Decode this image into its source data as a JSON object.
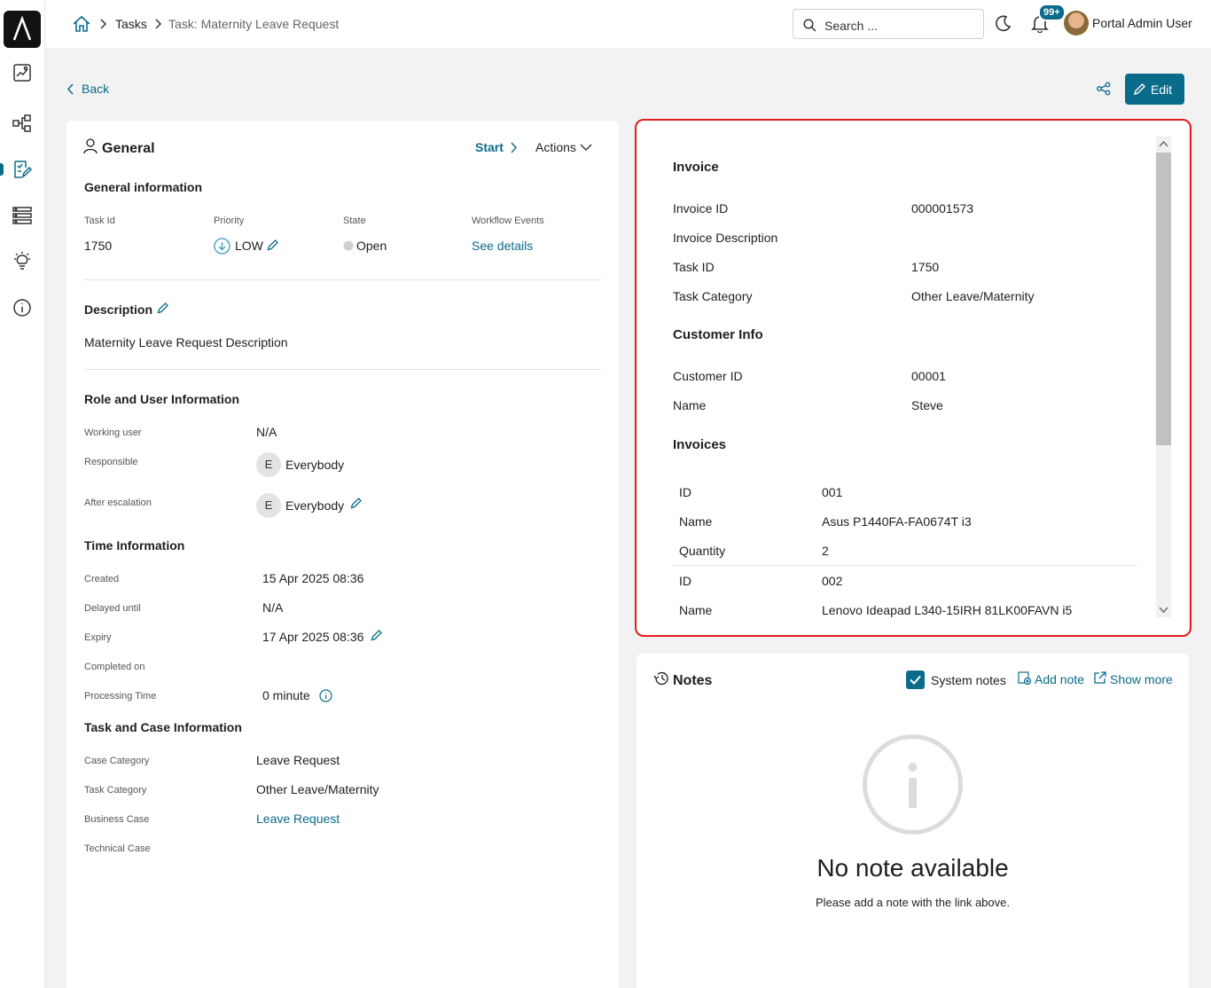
{
  "breadcrumb": {
    "home_icon": "home-icon",
    "tasks": "Tasks",
    "current": "Task: Maternity Leave Request"
  },
  "search": {
    "placeholder": "Search ..."
  },
  "notifications": {
    "badge": "99+"
  },
  "user": {
    "name": "Portal Admin User"
  },
  "toolbar": {
    "back": "Back",
    "edit": "Edit"
  },
  "general": {
    "title": "General",
    "start": "Start",
    "actions": "Actions",
    "info_heading": "General information",
    "task_id_label": "Task Id",
    "task_id": "1750",
    "priority_label": "Priority",
    "priority": "LOW",
    "state_label": "State",
    "state": "Open",
    "workflow_label": "Workflow Events",
    "workflow_link": "See details",
    "description_heading": "Description",
    "description": "Maternity Leave Request Description",
    "role_heading": "Role and User Information",
    "working_user_label": "Working user",
    "working_user": "N/A",
    "responsible_label": "Responsible",
    "responsible_initial": "E",
    "responsible": "Everybody",
    "after_escalation_label": "After escalation",
    "after_escalation_initial": "E",
    "after_escalation": "Everybody",
    "time_heading": "Time Information",
    "created_label": "Created",
    "created": "15 Apr 2025 08:36",
    "delayed_label": "Delayed until",
    "delayed": "N/A",
    "expiry_label": "Expiry",
    "expiry": "17 Apr 2025 08:36",
    "completed_label": "Completed on",
    "processing_label": "Processing Time",
    "processing": "0 minute",
    "case_heading": "Task and Case Information",
    "case_category_label": "Case Category",
    "case_category": "Leave Request",
    "task_category_label": "Task Category",
    "task_category": "Other Leave/Maternity",
    "business_case_label": "Business Case",
    "business_case": "Leave Request",
    "technical_case_label": "Technical Case"
  },
  "invoice_panel": {
    "invoice_heading": "Invoice",
    "invoice_id_label": "Invoice ID",
    "invoice_id": "000001573",
    "invoice_desc_label": "Invoice Description",
    "task_id_label": "Task ID",
    "task_id": "1750",
    "task_category_label": "Task Category",
    "task_category": "Other Leave/Maternity",
    "customer_heading": "Customer Info",
    "customer_id_label": "Customer ID",
    "customer_id": "00001",
    "name_label": "Name",
    "name": "Steve",
    "invoices_heading": "Invoices",
    "items": [
      {
        "id_label": "ID",
        "id": "001",
        "name_label": "Name",
        "name": "Asus P1440FA-FA0674T i3",
        "qty_label": "Quantity",
        "qty": "2"
      },
      {
        "id_label": "ID",
        "id": "002",
        "name_label": "Name",
        "name": "Lenovo Ideapad L340-15IRH 81LK00FAVN i5"
      }
    ]
  },
  "notes": {
    "title": "Notes",
    "system_notes": "System notes",
    "add_note": "Add note",
    "show_more": "Show more",
    "empty_title": "No note available",
    "empty_sub": "Please add a note with the link above."
  },
  "colors": {
    "accent": "#0a6b8a",
    "highlight": "#e21d1d"
  }
}
